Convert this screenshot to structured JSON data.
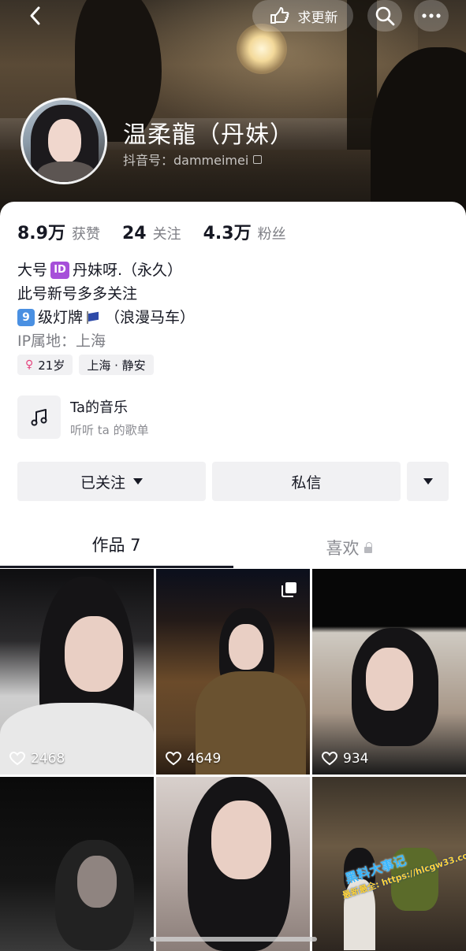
{
  "header": {
    "update_button_label": "求更新",
    "name": "温柔龍（丹妹）",
    "douyin_id": "抖音号：dammeimei"
  },
  "stats": [
    {
      "value": "8.9万",
      "label": "获赞"
    },
    {
      "value": "24",
      "label": "关注"
    },
    {
      "value": "4.3万",
      "label": "粉丝"
    }
  ],
  "bio": {
    "line1_prefix": "大号",
    "line1_badge": "ID",
    "line1_suffix": "丹妹呀.（永久）",
    "line2": "此号新号多多关注",
    "line3_badge": "9",
    "line3_text": "级灯牌",
    "line3_suffix": "（浪漫马车）",
    "ip_location": "IP属地：上海"
  },
  "tags": {
    "age": "21岁",
    "location": "上海 · 静安"
  },
  "music": {
    "title": "Ta的音乐",
    "subtitle": "听听 ta 的歌单"
  },
  "actions": {
    "followed_label": "已关注",
    "message_label": "私信"
  },
  "tabs": {
    "works_label": "作品 7",
    "likes_label": "喜欢"
  },
  "videos": [
    {
      "likes": "2468"
    },
    {
      "likes": "4649",
      "multi_image": true
    },
    {
      "likes": "934"
    },
    {
      "likes": ""
    },
    {
      "likes": ""
    },
    {
      "likes": ""
    }
  ],
  "watermark": {
    "top": "黑料大事记",
    "bottom": "最新最全: https://hlcgw33.com"
  },
  "colors": {
    "primary_text": "#161823",
    "secondary_text": "#7d7e84",
    "button_bg": "#f1f1f3",
    "id_badge": "#a64fd9",
    "level_badge": "#4a90e2",
    "female": "#e6447e"
  }
}
